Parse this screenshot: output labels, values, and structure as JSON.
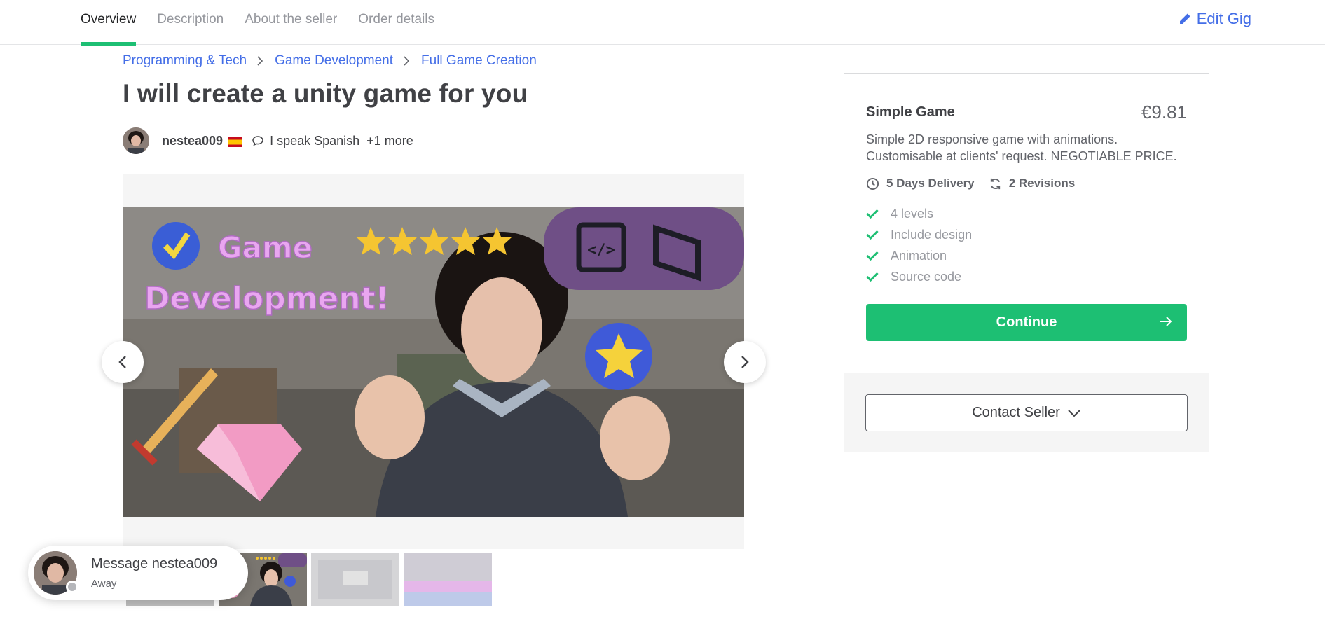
{
  "nav": {
    "tabs": [
      {
        "label": "Overview",
        "active": true
      },
      {
        "label": "Description",
        "active": false
      },
      {
        "label": "About the seller",
        "active": false
      },
      {
        "label": "Order details",
        "active": false
      }
    ],
    "edit_label": "Edit Gig"
  },
  "breadcrumb": [
    "Programming & Tech",
    "Game Development",
    "Full Game Creation"
  ],
  "gig": {
    "title": "I will create a unity game for you"
  },
  "seller": {
    "name": "nestea009",
    "country_flag": "spain-flag-icon",
    "speaks": "I speak Spanish",
    "more_languages": "+1 more"
  },
  "gallery": {
    "image_text_line1": "Game",
    "image_text_line2": "Development!",
    "thumbnail_count": 4,
    "active_thumbnail": 2
  },
  "message": {
    "title": "Message nestea009",
    "status": "Away"
  },
  "package": {
    "name": "Simple Game",
    "price": "€9.81",
    "description": "Simple 2D responsive game with animations. Customisable at clients' request. NEGOTIABLE PRICE.",
    "delivery": "5 Days Delivery",
    "revisions": "2 Revisions",
    "features": [
      "4 levels",
      "Include design",
      "Animation",
      "Source code"
    ],
    "continue_label": "Continue"
  },
  "contact": {
    "label": "Contact Seller"
  },
  "colors": {
    "accent_green": "#1dbf73",
    "link_blue": "#446ee7",
    "badge_purple": "#6f4f86"
  }
}
